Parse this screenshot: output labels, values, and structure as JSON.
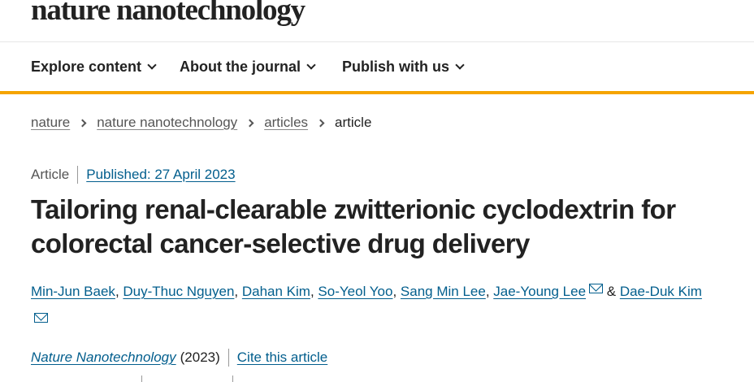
{
  "masthead": {
    "logo": "nature nanotechnology"
  },
  "nav": {
    "items": [
      {
        "label": "Explore content"
      },
      {
        "label": "About the journal"
      },
      {
        "label": "Publish with us"
      }
    ]
  },
  "breadcrumb": {
    "items": [
      "nature",
      "nature nanotechnology",
      "articles"
    ],
    "current": "article"
  },
  "article": {
    "type": "Article",
    "published": "Published: 27 April 2023",
    "title": "Tailoring renal-clearable zwitterionic cyclodextrin for colorectal cancer-selective drug delivery",
    "authors": [
      "Min-Jun Baek",
      "Duy-Thuc Nguyen",
      "Dahan Kim",
      "So-Yeol Yoo",
      "Sang Min Lee",
      "Jae-Young Lee",
      "Dae-Duk Kim"
    ],
    "author_separator": ", ",
    "author_and": " & ",
    "journal": "Nature Nanotechnology",
    "year": "(2023)",
    "cite_label": "Cite this article"
  },
  "icons": {
    "mail": "envelope-icon",
    "nav_chevron": "chevron-down-icon",
    "crumb_sep": "chevron-right-icon"
  },
  "colors": {
    "accent": "#f5a400",
    "link": "#025e8d",
    "text": "#222222"
  }
}
